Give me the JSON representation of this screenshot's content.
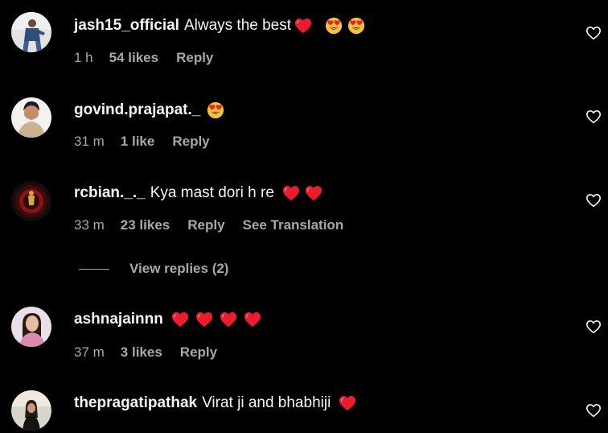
{
  "comments": [
    {
      "username": "jash15_official",
      "text": "Always the best",
      "emojis": [
        "red-heart",
        "heart-eyes",
        "heart-eyes"
      ],
      "time": "1 h",
      "likes": "54 likes",
      "reply": "Reply"
    },
    {
      "username": "govind.prajapat._",
      "text": "",
      "emojis": [
        "heart-eyes"
      ],
      "time": "31 m",
      "likes": "1 like",
      "reply": "Reply"
    },
    {
      "username": "rcbian._._",
      "text": "Kya mast dori h re",
      "emojis": [
        "red-heart",
        "red-heart"
      ],
      "time": "33 m",
      "likes": "23 likes",
      "reply": "Reply",
      "translation": "See Translation"
    },
    {
      "username": "ashnajainnn",
      "text": "",
      "emojis": [
        "red-heart",
        "red-heart",
        "red-heart",
        "red-heart"
      ],
      "time": "37 m",
      "likes": "3 likes",
      "reply": "Reply"
    },
    {
      "username": "thepragatipathak",
      "text": "Virat ji and bhabhiji",
      "emojis": [
        "red-heart"
      ]
    }
  ],
  "view_replies": "View replies (2)",
  "colors": {
    "background": "#000000",
    "text": "#f5f5f5",
    "muted": "#a8a8a8",
    "heart": "#ed1b2e",
    "emoji_face": "#f7c23a"
  }
}
